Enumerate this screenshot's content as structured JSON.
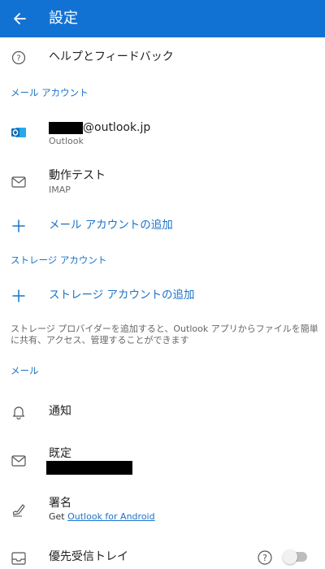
{
  "header": {
    "title": "設定",
    "background": "#1272d3"
  },
  "help_row": {
    "label": "ヘルプとフィードバック",
    "icon": "help-circle-icon"
  },
  "mail_accounts_section": {
    "header": "メール アカウント",
    "accounts": [
      {
        "email_suffix": "@outlook.jp",
        "type": "Outlook",
        "icon": "outlook-icon"
      },
      {
        "name": "動作テスト",
        "type": "IMAP",
        "icon": "mail-icon"
      }
    ],
    "add_label": "メール アカウントの追加"
  },
  "storage_section": {
    "header": "ストレージ アカウント",
    "add_label": "ストレージ アカウントの追加",
    "description": "ストレージ プロバイダーを追加すると、Outlook アプリからファイルを簡単に共有、アクセス、管理することができます"
  },
  "mail_section": {
    "header": "メール",
    "notifications_label": "通知",
    "default_label": "既定",
    "signature_label": "署名",
    "signature_prefix": "Get ",
    "signature_link": "Outlook for Android",
    "focused_inbox_label": "優先受信トレイ"
  },
  "colors": {
    "accent": "#1a73c9",
    "outlook_blue": "#0f6cbd"
  }
}
